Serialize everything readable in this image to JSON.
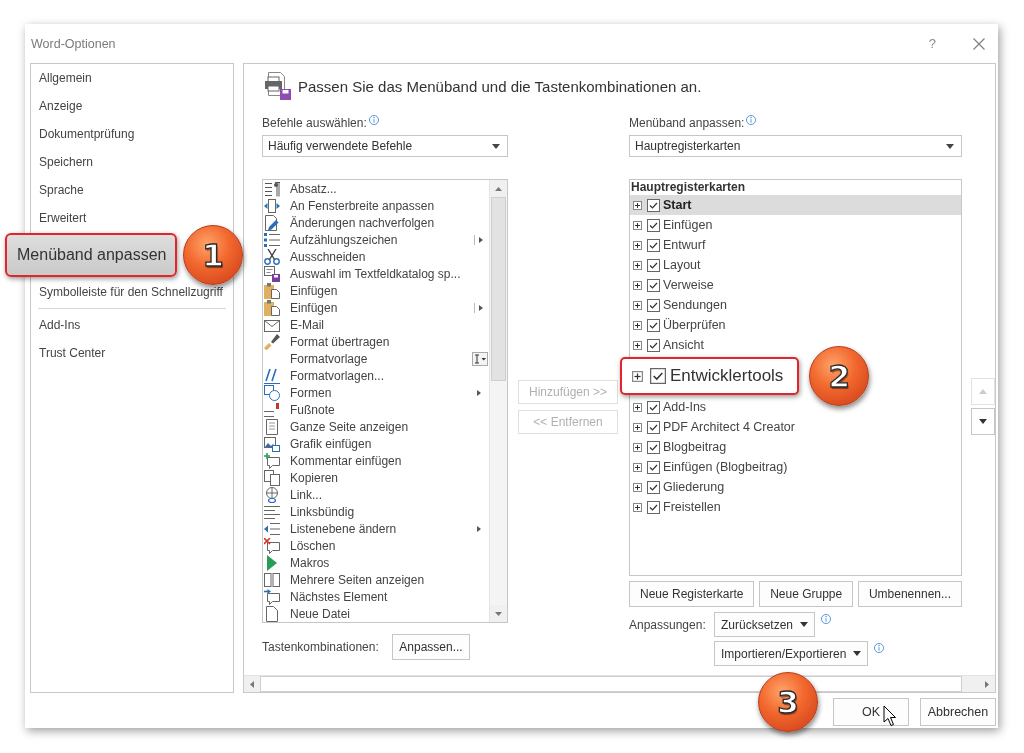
{
  "window": {
    "title": "Word-Optionen",
    "help": "?"
  },
  "sidebar": {
    "sections": [
      {
        "items": [
          {
            "label": "Allgemein",
            "selected": false
          },
          {
            "label": "Anzeige",
            "selected": false
          },
          {
            "label": "Dokumentprüfung",
            "selected": false
          },
          {
            "label": "Speichern",
            "selected": false
          },
          {
            "label": "Sprache",
            "selected": false
          },
          {
            "label": "Erweitert",
            "selected": false
          },
          {
            "label": "Menüband anpassen",
            "selected": true,
            "callout": "1"
          },
          {
            "label": "Symbolleiste für den Schnellzugriff",
            "selected": false
          }
        ]
      },
      {
        "items": [
          {
            "label": "Add-Ins",
            "selected": false
          },
          {
            "label": "Trust Center",
            "selected": false
          }
        ]
      }
    ]
  },
  "heading": "Passen Sie das Menüband und die Tastenkombinationen an.",
  "commands": {
    "label": "Befehle auswählen:",
    "dropdown": "Häufig verwendete Befehle",
    "items": [
      {
        "label": "Absatz...",
        "kind": "plain"
      },
      {
        "label": "An Fensterbreite anpassen",
        "kind": "plain"
      },
      {
        "label": "Änderungen nachverfolgen",
        "kind": "plain"
      },
      {
        "label": "Aufzählungszeichen",
        "kind": "split"
      },
      {
        "label": "Ausschneiden",
        "kind": "plain"
      },
      {
        "label": "Auswahl im Textfeldkatalog sp...",
        "kind": "plain"
      },
      {
        "label": "Einfügen",
        "kind": "plain"
      },
      {
        "label": "Einfügen",
        "kind": "split"
      },
      {
        "label": "E-Mail",
        "kind": "plain"
      },
      {
        "label": "Format übertragen",
        "kind": "plain"
      },
      {
        "label": "Formatvorlage",
        "kind": "style"
      },
      {
        "label": "Formatvorlagen...",
        "kind": "plain"
      },
      {
        "label": "Formen",
        "kind": "menu"
      },
      {
        "label": "Fußnote",
        "kind": "plain"
      },
      {
        "label": "Ganze Seite anzeigen",
        "kind": "plain"
      },
      {
        "label": "Grafik einfügen",
        "kind": "plain"
      },
      {
        "label": "Kommentar einfügen",
        "kind": "plain"
      },
      {
        "label": "Kopieren",
        "kind": "plain"
      },
      {
        "label": "Link...",
        "kind": "plain"
      },
      {
        "label": "Linksbündig",
        "kind": "plain"
      },
      {
        "label": "Listenebene ändern",
        "kind": "menu"
      },
      {
        "label": "Löschen",
        "kind": "plain"
      },
      {
        "label": "Makros",
        "kind": "plain"
      },
      {
        "label": "Mehrere Seiten anzeigen",
        "kind": "plain"
      },
      {
        "label": "Nächstes Element",
        "kind": "plain"
      },
      {
        "label": "Neue Datei",
        "kind": "plain"
      }
    ]
  },
  "transfer_buttons": [
    {
      "label": "Hinzufügen >>",
      "disabled": true
    },
    {
      "label": "<< Entfernen",
      "disabled": true
    }
  ],
  "ribbon": {
    "label": "Menüband anpassen:",
    "dropdown": "Hauptregisterkarten",
    "tree": {
      "heading": "Hauptregisterkarten",
      "items": [
        {
          "label": "Start",
          "checked": true,
          "expanded": false,
          "selected": true
        },
        {
          "label": "Einfügen",
          "checked": true,
          "expanded": false,
          "selected": false
        },
        {
          "label": "Entwurf",
          "checked": true,
          "expanded": false,
          "selected": false
        },
        {
          "label": "Layout",
          "checked": true,
          "expanded": false,
          "selected": false
        },
        {
          "label": "Verweise",
          "checked": true,
          "expanded": false,
          "selected": false
        },
        {
          "label": "Sendungen",
          "checked": true,
          "expanded": false,
          "selected": false
        },
        {
          "label": "Überprüfen",
          "checked": true,
          "expanded": false,
          "selected": false
        },
        {
          "label": "Ansicht",
          "checked": true,
          "expanded": false,
          "selected": false
        },
        {
          "label": "Entwicklertools",
          "checked": true,
          "expanded": false,
          "selected": false,
          "callout": "2"
        },
        {
          "label": "Add-Ins",
          "checked": true,
          "expanded": false,
          "selected": false
        },
        {
          "label": "PDF Architect 4 Creator",
          "checked": true,
          "expanded": false,
          "selected": false
        },
        {
          "label": "Blogbeitrag",
          "checked": true,
          "expanded": false,
          "selected": false
        },
        {
          "label": "Einfügen (Blogbeitrag)",
          "checked": true,
          "expanded": false,
          "selected": false
        },
        {
          "label": "Gliederung",
          "checked": true,
          "expanded": false,
          "selected": false
        },
        {
          "label": "Freistellen",
          "checked": true,
          "expanded": false,
          "selected": false
        }
      ]
    },
    "buttons": [
      "Neue Registerkarte",
      "Neue Gruppe",
      "Umbenennen..."
    ],
    "customizations": {
      "label": "Anpassungen:",
      "menus": [
        "Zurücksetzen",
        "Importieren/Exportieren"
      ]
    }
  },
  "move_buttons": [
    {
      "kind": "up",
      "disabled": true
    },
    {
      "kind": "down",
      "disabled": false
    }
  ],
  "shortcuts": {
    "label": "Tastenkombinationen:",
    "button": "Anpassen..."
  },
  "footer": {
    "buttons": [
      {
        "label": "OK",
        "callout": "3",
        "cursor": true
      },
      {
        "label": "Abbrechen"
      }
    ]
  }
}
